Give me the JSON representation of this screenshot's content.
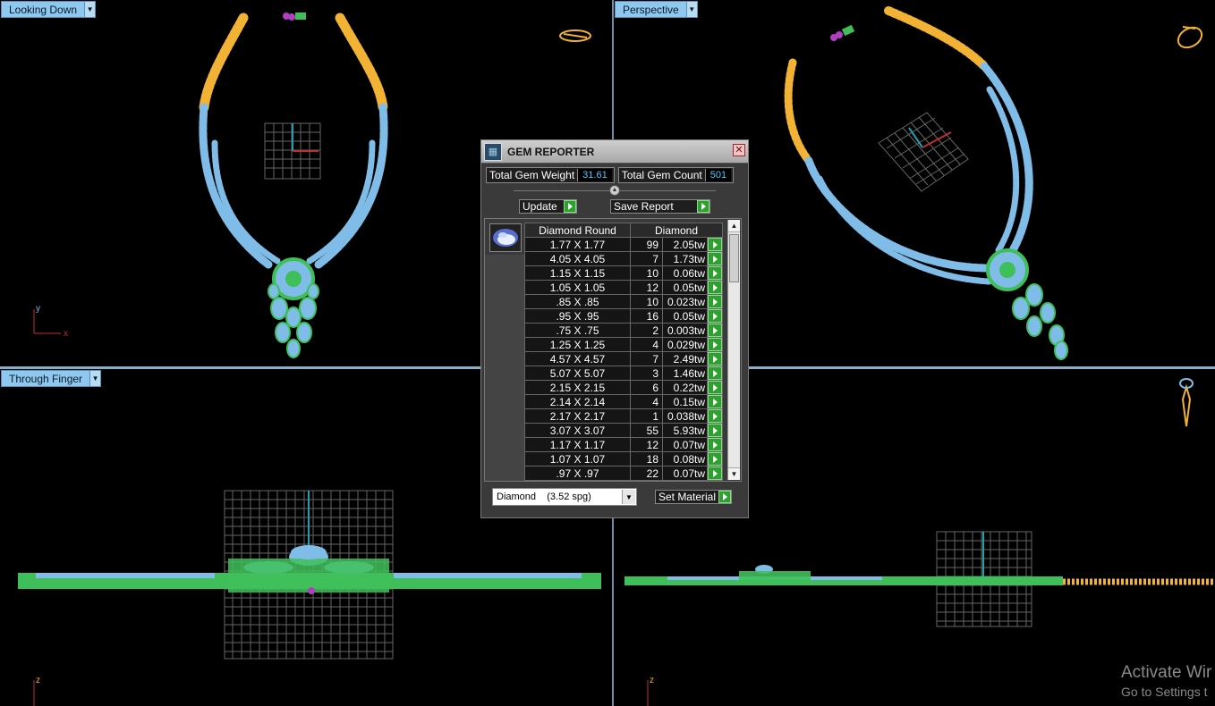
{
  "viewports": {
    "top_left": {
      "label": "Looking Down"
    },
    "top_right": {
      "label": "Perspective"
    },
    "bottom_left": {
      "label": "Through Finger"
    },
    "bottom_right": {
      "label": ""
    }
  },
  "axes": {
    "y": "y",
    "x": "x",
    "z": "z"
  },
  "gem_reporter": {
    "title": "GEM REPORTER",
    "total_weight_label": "Total Gem Weight",
    "total_weight_value": "31.61",
    "total_count_label": "Total Gem Count",
    "total_count_value": "501",
    "update_label": "Update",
    "save_report_label": "Save Report",
    "table": {
      "header_shape": "Diamond Round",
      "header_material": "Diamond",
      "rows": [
        {
          "size": "1.77 X 1.77",
          "count": "99",
          "weight": "2.05tw"
        },
        {
          "size": "4.05 X 4.05",
          "count": "7",
          "weight": "1.73tw"
        },
        {
          "size": "1.15 X 1.15",
          "count": "10",
          "weight": "0.06tw"
        },
        {
          "size": "1.05 X 1.05",
          "count": "12",
          "weight": "0.05tw"
        },
        {
          "size": ".85 X .85",
          "count": "10",
          "weight": "0.023tw"
        },
        {
          "size": ".95 X .95",
          "count": "16",
          "weight": "0.05tw"
        },
        {
          "size": ".75 X .75",
          "count": "2",
          "weight": "0.003tw"
        },
        {
          "size": "1.25 X 1.25",
          "count": "4",
          "weight": "0.029tw"
        },
        {
          "size": "4.57 X 4.57",
          "count": "7",
          "weight": "2.49tw"
        },
        {
          "size": "5.07 X 5.07",
          "count": "3",
          "weight": "1.46tw"
        },
        {
          "size": "2.15 X 2.15",
          "count": "6",
          "weight": "0.22tw"
        },
        {
          "size": "2.14 X 2.14",
          "count": "4",
          "weight": "0.15tw"
        },
        {
          "size": "2.17 X 2.17",
          "count": "1",
          "weight": "0.038tw"
        },
        {
          "size": "3.07 X 3.07",
          "count": "55",
          "weight": "5.93tw"
        },
        {
          "size": "1.17 X 1.17",
          "count": "12",
          "weight": "0.07tw"
        },
        {
          "size": "1.07 X 1.07",
          "count": "18",
          "weight": "0.08tw"
        },
        {
          "size": ".97 X .97",
          "count": "22",
          "weight": "0.07tw"
        }
      ]
    },
    "material_select": "Diamond    (3.52 spg)",
    "set_material_label": "Set Material"
  },
  "watermark": {
    "line1": "Activate Wir",
    "line2": "Go to Settings t"
  },
  "colors": {
    "gold": "#f2b233",
    "stone": "#7fbde8",
    "setting": "#3fbf5a",
    "label_bg": "#8ec8ee"
  }
}
